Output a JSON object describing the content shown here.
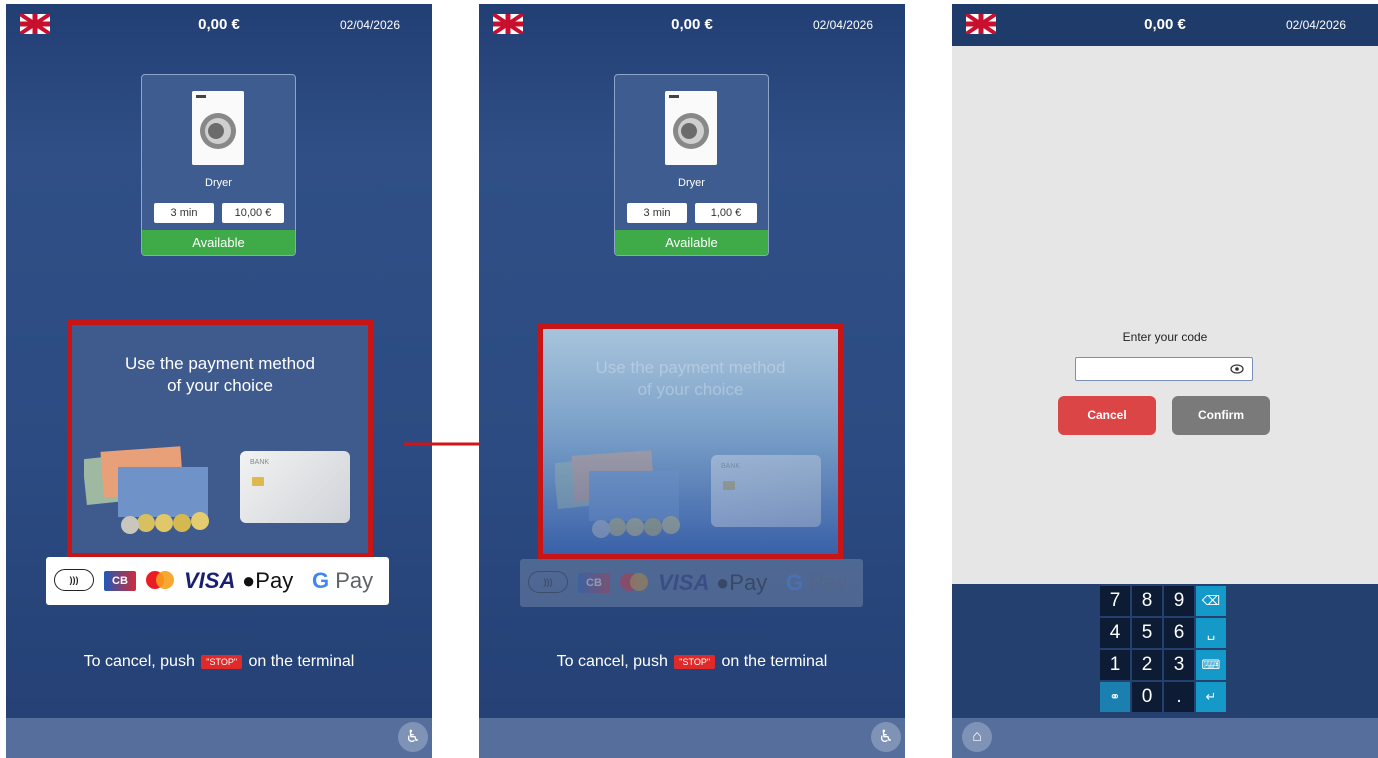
{
  "header": {
    "balance": "0,00 €",
    "date": "02/04/2026"
  },
  "machine": {
    "name": "Dryer",
    "duration": "3 min",
    "status": "Available"
  },
  "screens": [
    {
      "price": "10,00 €"
    },
    {
      "price": "1,00 €"
    }
  ],
  "payment": {
    "line1": "Use the payment method",
    "line2": "of your choice",
    "card_bank": "BANK",
    "logos": {
      "cb": "CB",
      "visa": "VISA",
      "apple_pay": "Pay",
      "google_pay_g": "G",
      "google_pay": " Pay"
    }
  },
  "cancel_hint": {
    "before": "To cancel, push",
    "badge": "\"STOP\"",
    "after": "on the terminal"
  },
  "code_entry": {
    "label": "Enter your code",
    "cancel": "Cancel",
    "confirm": "Confirm"
  },
  "keypad": {
    "rows": [
      [
        "7",
        "8",
        "9"
      ],
      [
        "4",
        "5",
        "6"
      ],
      [
        "1",
        "2",
        "3"
      ],
      [
        "",
        "0",
        "."
      ]
    ]
  },
  "icons": {
    "flag": "uk-flag-icon",
    "access": "wheelchair-icon",
    "home": "home-icon",
    "eye": "eye-icon",
    "backspace": "backspace-icon",
    "space": "space-icon",
    "keyboard": "keyboard-icon",
    "globe": "globe-icon",
    "enter": "enter-icon"
  },
  "colors": {
    "accent_red": "#c81414",
    "available_green": "#3eaa48",
    "cancel_btn": "#dc4545",
    "confirm_btn": "#7a7a7a",
    "key_fn": "#1499c8"
  }
}
